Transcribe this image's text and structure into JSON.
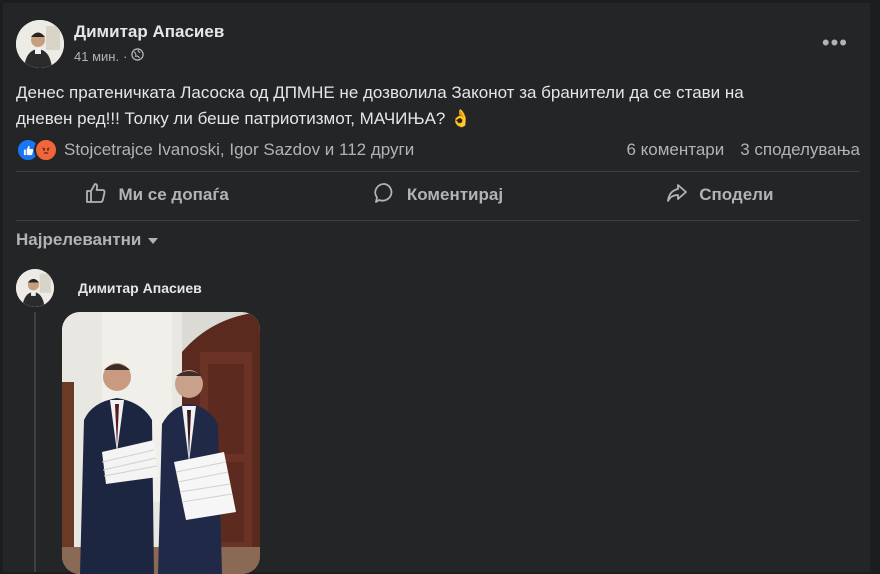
{
  "post": {
    "author": "Димитар Апасиев",
    "time": "41 мин.",
    "separator": "·",
    "text_line1": "Денес пратеничката Ласоска од ДПМНЕ не дозволила Законот за бранители да се стави на",
    "text_line2": "дневен ред!!! Толку ли беше патриотизмот, МАЧИЊА?",
    "emoji": "👌",
    "reactions_text": "Stojcetrajce Ivanoski, Igor Sazdov и 112 други",
    "comments_count": "6 коментари",
    "shares_count": "3 споделувања",
    "more_label": "•••"
  },
  "actions": {
    "like": "Ми се допаѓа",
    "comment": "Коментирај",
    "share": "Сподели"
  },
  "comments": {
    "sort_label": "Најрелевантни",
    "first_author": "Димитар Апасиев"
  },
  "colors": {
    "background": "#242526",
    "text": "#e4e6eb",
    "muted": "#b0b3b8",
    "like_blue": "#1877f2",
    "angry_orange": "#f0663a"
  },
  "icons": [
    "globe-icon",
    "more-icon",
    "like-reaction-icon",
    "angry-reaction-icon",
    "thumbs-up-icon",
    "comment-icon",
    "share-icon",
    "chevron-down-icon"
  ]
}
